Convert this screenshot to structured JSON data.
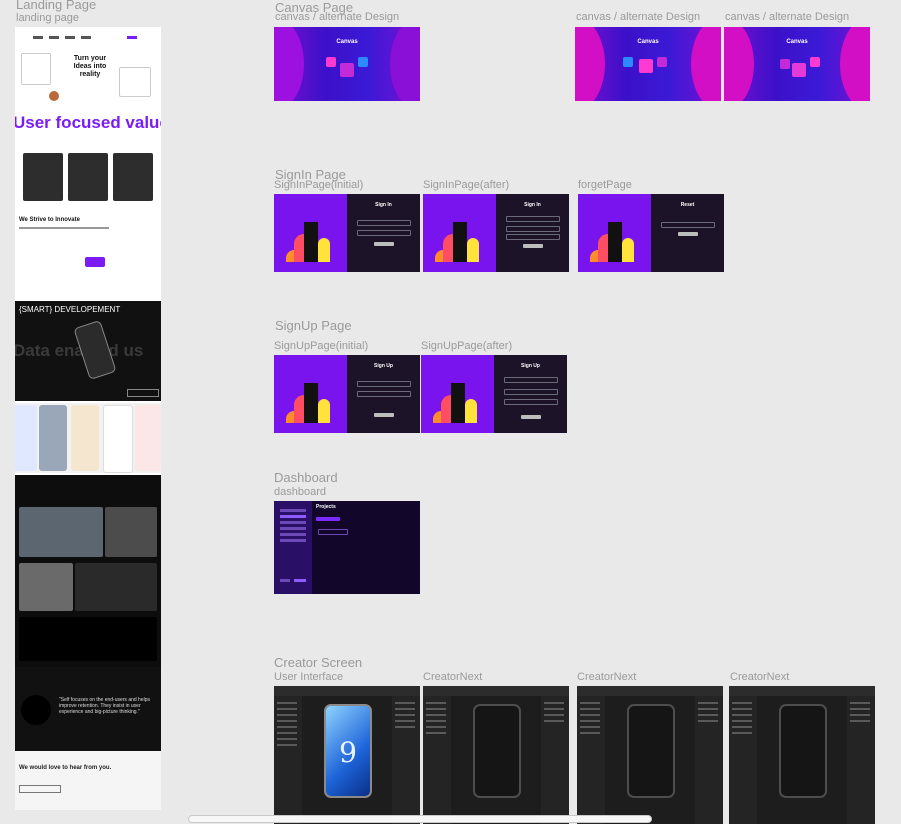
{
  "sections": {
    "landing": {
      "title": "Landing Page",
      "frame_label": "landing page",
      "content": {
        "hero_title": "Turn your Ideas into reality",
        "big_headline": "User focused value",
        "strive_heading": "We Strive to Innovate",
        "smart_heading": "{SMART} DEVELOPEMENT",
        "ghost_text": "Data enabled us",
        "quote": "\"Self focuses on the end-users and helps improve retention. They insist in user experience and big-picture thinking.\"",
        "footer_heading": "We would love to hear from you."
      }
    },
    "canvas": {
      "title": "Canvas Page",
      "frames": [
        {
          "label": "canvas / alternate Design",
          "heading": "Canvas"
        },
        {
          "label": "canvas / alternate Design",
          "heading": "Canvas"
        },
        {
          "label": "canvas / alternate Design",
          "heading": "Canvas"
        }
      ]
    },
    "signin": {
      "title": "SignIn Page",
      "frames": [
        {
          "label": "SignInPage(initial)",
          "heading": "Sign In"
        },
        {
          "label": "SignInPage(after)",
          "heading": "Sign In"
        },
        {
          "label": "forgetPage",
          "heading": "Reset"
        }
      ]
    },
    "signup": {
      "title": "SignUp Page",
      "frames": [
        {
          "label": "SignUpPage(initial)",
          "heading": "Sign Up"
        },
        {
          "label": "SignUpPage(after)",
          "heading": "Sign Up"
        }
      ]
    },
    "dashboard": {
      "title": "Dashboard",
      "frame_label": "dashboard",
      "heading": "Projects"
    },
    "creator": {
      "title": "Creator Screen",
      "frames": [
        {
          "label": "User Interface",
          "phone_text": "9"
        },
        {
          "label": "CreatorNext"
        },
        {
          "label": "CreatorNext"
        },
        {
          "label": "CreatorNext"
        }
      ]
    }
  },
  "colors": {
    "canvas_bg": "#e9e9e9",
    "label_gray": "#9a9a9a",
    "brand_purple": "#7b1cf7",
    "dark_panel": "#1c1328"
  }
}
